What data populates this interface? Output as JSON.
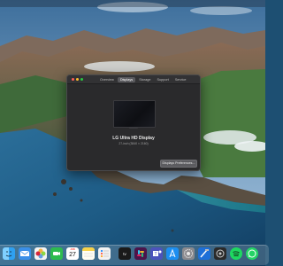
{
  "window": {
    "tabs": [
      {
        "label": "Overview",
        "active": false
      },
      {
        "label": "Displays",
        "active": true
      },
      {
        "label": "Storage",
        "active": false
      },
      {
        "label": "Support",
        "active": false
      },
      {
        "label": "Service",
        "active": false
      }
    ],
    "display_name": "LG Ultra HD Display",
    "display_spec": "27-inch (3840 × 2160)",
    "prefs_button_label": "Displays Preferences..."
  },
  "dock": {
    "calendar": {
      "month": "JUN",
      "day": "27"
    },
    "apps": [
      {
        "name": "finder",
        "color": "#2fa0f0"
      },
      {
        "name": "mail",
        "color": "#3a8fe8"
      },
      {
        "name": "photos",
        "color": "#f4f4f4"
      },
      {
        "name": "facetime",
        "color": "#2dbb4f"
      },
      {
        "name": "calendar",
        "color": "#ffffff"
      },
      {
        "name": "notes",
        "color": "#f7d24b"
      },
      {
        "name": "reminders",
        "color": "#f2f2f2"
      },
      {
        "name": "apple-tv",
        "color": "#1a1a1a"
      },
      {
        "name": "slack",
        "color": "#4a154b"
      },
      {
        "name": "teams",
        "color": "#4b53bc"
      },
      {
        "name": "app-store",
        "color": "#1c8ef0"
      },
      {
        "name": "system-preferences",
        "color": "#8a8a8e"
      },
      {
        "name": "xcode",
        "color": "#1d6fd8"
      },
      {
        "name": "capture-one",
        "color": "#2a2a2a"
      },
      {
        "name": "spotify",
        "color": "#1ed760"
      },
      {
        "name": "whatsapp",
        "color": "#25d366"
      },
      {
        "name": "script-app",
        "color": "#333333"
      },
      {
        "name": "ios-app-installer",
        "color": "#5ac8fa"
      }
    ]
  },
  "colors": {
    "window_bg": "#2a2a2c",
    "active_tab": "#5a5a5e",
    "close": "#ff5f57",
    "minimize": "#febc2e",
    "zoom": "#28c840"
  }
}
